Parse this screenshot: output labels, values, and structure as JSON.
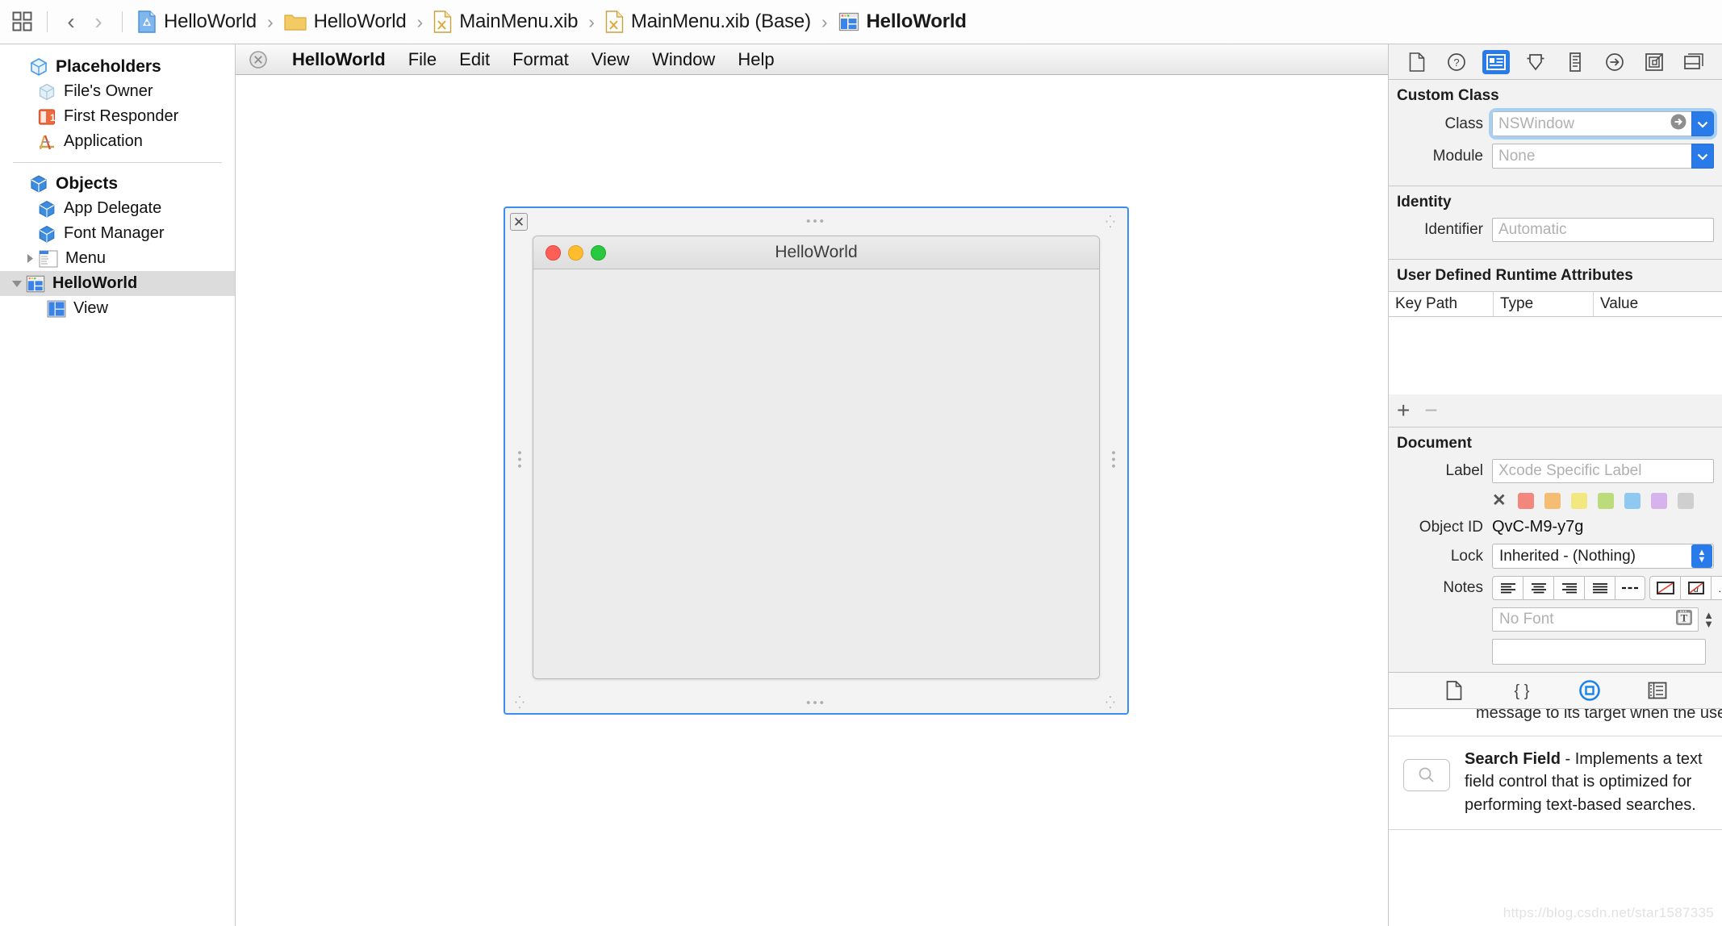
{
  "jumpbar": {
    "grid_icon": "grid-icon",
    "back_label": "‹",
    "forward_label": "›",
    "breadcrumbs": [
      {
        "label": "HelloWorld",
        "icon": "xcode-project-icon",
        "bold": false
      },
      {
        "label": "HelloWorld",
        "icon": "folder-icon",
        "bold": false
      },
      {
        "label": "MainMenu.xib",
        "icon": "xib-file-icon",
        "bold": false
      },
      {
        "label": "MainMenu.xib (Base)",
        "icon": "xib-file-icon",
        "bold": false
      },
      {
        "label": "HelloWorld",
        "icon": "window-object-icon",
        "bold": true
      }
    ],
    "separator": "›"
  },
  "sidebar": {
    "groups": [
      {
        "header": {
          "label": "Placeholders",
          "icon": "placeholder-cube-icon"
        },
        "items": [
          {
            "label": "File's Owner",
            "icon": "files-owner-cube-icon"
          },
          {
            "label": "First Responder",
            "icon": "first-responder-icon"
          },
          {
            "label": "Application",
            "icon": "application-icon"
          }
        ]
      },
      {
        "header": {
          "label": "Objects",
          "icon": "objects-cube-icon"
        },
        "items": [
          {
            "label": "App Delegate",
            "icon": "blue-cube-icon"
          },
          {
            "label": "Font Manager",
            "icon": "blue-cube-icon"
          },
          {
            "label": "Menu",
            "icon": "menu-icon",
            "twisty": "▶"
          }
        ]
      }
    ],
    "selected": {
      "label": "HelloWorld",
      "icon": "window-object-icon",
      "twisty": "▼"
    },
    "child": {
      "label": "View",
      "icon": "view-object-icon"
    }
  },
  "canvas": {
    "menubar": {
      "close_icon": "menu-close-icon",
      "items": [
        "HelloWorld",
        "File",
        "Edit",
        "Format",
        "View",
        "Window",
        "Help"
      ]
    },
    "window": {
      "title": "HelloWorld",
      "close_label": "✕",
      "handle_dots": "•••",
      "traffic_lights": [
        "#ff5f57",
        "#ffbd2e",
        "#28c940"
      ]
    }
  },
  "inspector": {
    "toolbar": [
      {
        "name": "file-inspector-icon",
        "active": false
      },
      {
        "name": "quick-help-inspector-icon",
        "active": false
      },
      {
        "name": "identity-inspector-icon",
        "active": true
      },
      {
        "name": "attributes-inspector-icon",
        "active": false
      },
      {
        "name": "size-inspector-icon",
        "active": false
      },
      {
        "name": "connections-inspector-icon",
        "active": false
      },
      {
        "name": "bindings-inspector-icon",
        "active": false
      },
      {
        "name": "view-effects-inspector-icon",
        "active": false
      }
    ],
    "custom_class": {
      "title": "Custom Class",
      "class_label": "Class",
      "class_value": "NSWindow",
      "module_label": "Module",
      "module_value": "None"
    },
    "identity": {
      "title": "Identity",
      "identifier_label": "Identifier",
      "identifier_placeholder": "Automatic"
    },
    "runtime": {
      "title": "User Defined Runtime Attributes",
      "columns": [
        "Key Path",
        "Type",
        "Value"
      ],
      "rows": [],
      "add_label": "+",
      "remove_label": "−"
    },
    "document": {
      "title": "Document",
      "label_label": "Label",
      "label_placeholder": "Xcode Specific Label",
      "swatch_clear": "✕",
      "swatches": [
        "#f4877d",
        "#f5bd74",
        "#f2e87f",
        "#bcdb7a",
        "#8fc9f2",
        "#d7b3ee",
        "#cfcfcf"
      ],
      "object_id_label": "Object ID",
      "object_id_value": "QvC-M9-y7g",
      "lock_label": "Lock",
      "lock_value": "Inherited - (Nothing)",
      "notes_label": "Notes",
      "notes_font_placeholder": "No Font",
      "notes_more": "…",
      "notes_value": ""
    }
  },
  "library": {
    "tabs": [
      {
        "name": "file-template-library-icon",
        "active": false
      },
      {
        "name": "code-snippet-library-icon",
        "active": false
      },
      {
        "name": "object-library-icon",
        "active": true
      },
      {
        "name": "media-library-icon",
        "active": false
      }
    ],
    "clipped_item_text": "message to its target when the user pre…",
    "items": [
      {
        "thumb": "search-field-icon",
        "title": "Search Field",
        "dash": " - ",
        "description": "Implements a text field control that is optimized for performing text-based searches."
      }
    ],
    "watermark": "https://blog.csdn.net/star1587335"
  }
}
